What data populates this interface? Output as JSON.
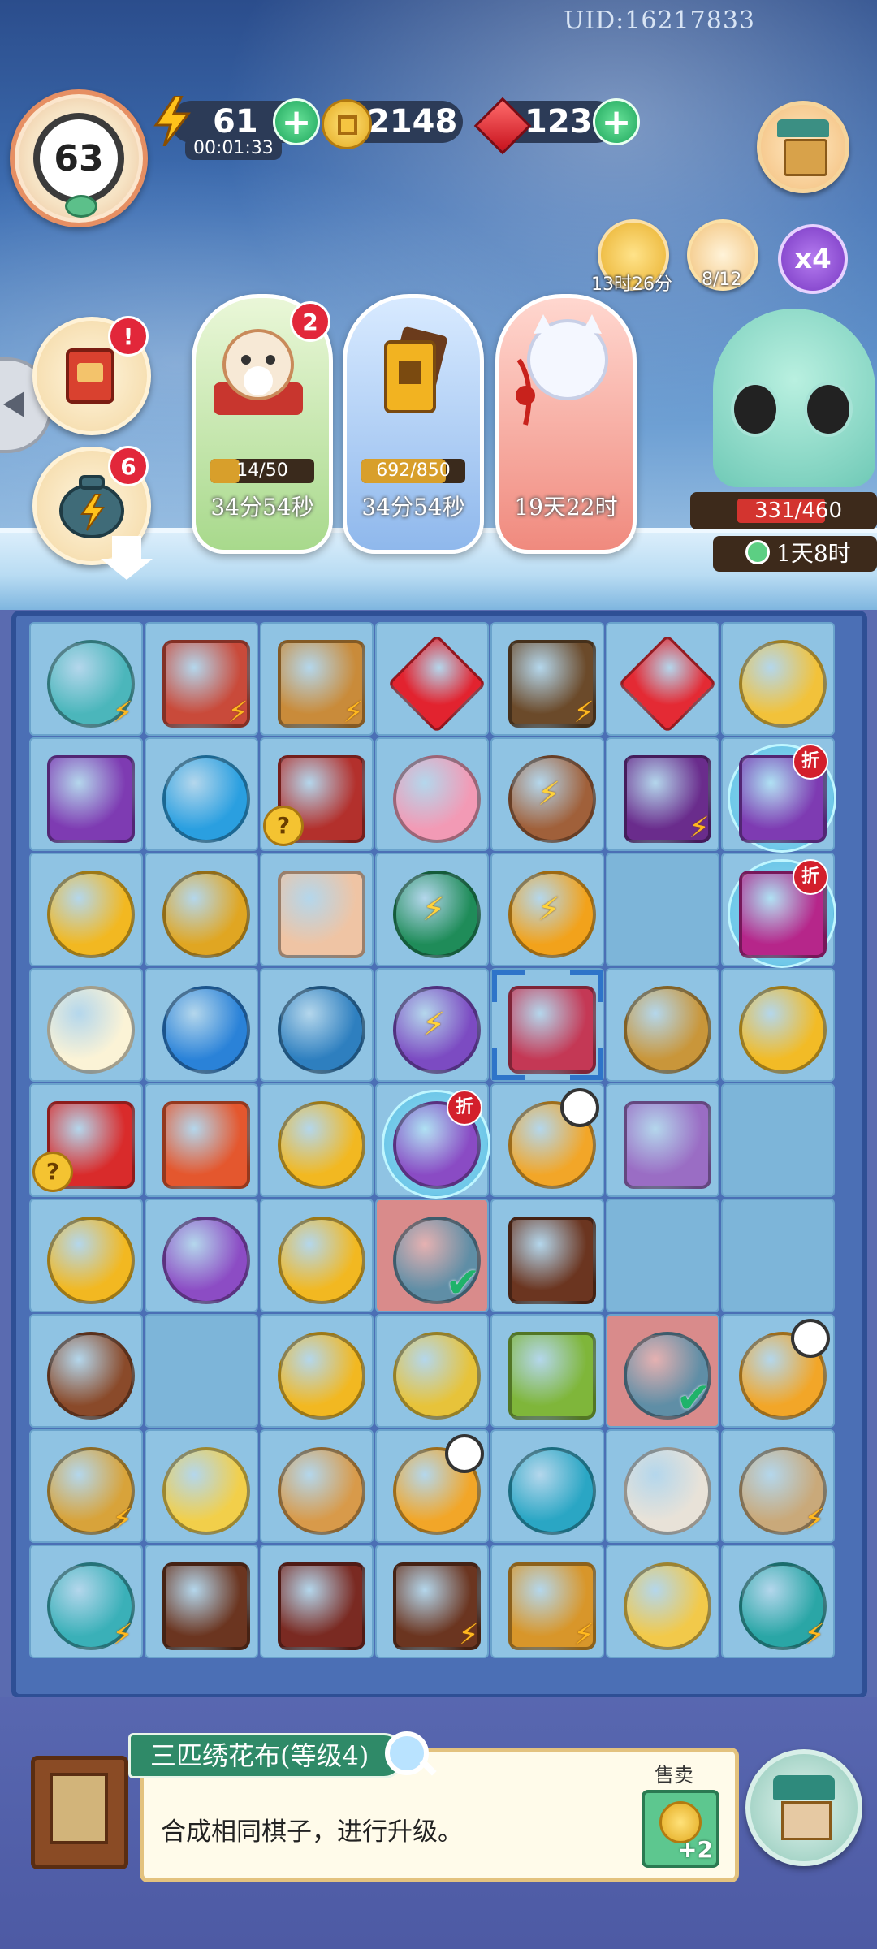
{
  "header": {
    "uid": "UID:16217833",
    "level": "63",
    "energy": {
      "value": "61",
      "timer": "00:01:33"
    },
    "coins": {
      "value": "2148"
    },
    "gems": {
      "value": "123"
    },
    "speed_multiplier": "x4",
    "timers": [
      {
        "icon": "wok-icon",
        "label": "13时26分"
      },
      {
        "icon": "cat-face-icon",
        "label": "8/12"
      }
    ]
  },
  "left_buttons": [
    {
      "icon": "book-icon",
      "badge": "!"
    },
    {
      "icon": "teapot-icon",
      "badge": "6"
    }
  ],
  "event_cards": [
    {
      "name": "cat-pillow-event",
      "badge": "2",
      "progress_text": "14/50",
      "progress": 0.28,
      "time": "34分54秒"
    },
    {
      "name": "ticket-event",
      "progress_text": "692/850",
      "progress": 0.81,
      "time": "34分54秒"
    },
    {
      "name": "lantern-event",
      "time": "19天22时"
    }
  ],
  "cat_panel": {
    "progress_text": "331/460",
    "progress": 0.72,
    "time": "1天8时"
  },
  "board": {
    "rows": [
      [
        {
          "icon": "teapot-icon",
          "color": "#4bb6bb",
          "shape": "round",
          "bolt": true
        },
        {
          "icon": "watermelon-crate-icon",
          "color": "#c94a3a",
          "shape": "square",
          "bolt": true
        },
        {
          "icon": "scroll-basket-icon",
          "color": "#c98b3a",
          "shape": "square",
          "bolt": true
        },
        {
          "icon": "ruby-cluster-icon",
          "color": "#e2232f",
          "shape": "diamond"
        },
        {
          "icon": "treasure-chest-icon",
          "color": "#6b4a2a",
          "shape": "square",
          "bolt": true
        },
        {
          "icon": "ruby-icon",
          "color": "#e42a34",
          "shape": "diamond"
        },
        {
          "icon": "jade-bracelet-icon",
          "color": "#f2c23a",
          "shape": "round"
        }
      ],
      [
        {
          "icon": "embroidered-pouch-icon",
          "color": "#7e3bb2",
          "shape": "square"
        },
        {
          "icon": "earrings-icon",
          "color": "#2a9fe0",
          "shape": "round"
        },
        {
          "icon": "mystery-box-icon",
          "color": "#b3302c",
          "shape": "square",
          "question": true
        },
        {
          "icon": "plum-blossom-icon",
          "color": "#f29ab5",
          "shape": "round"
        },
        {
          "icon": "gourd-bolt-icon",
          "color": "#a0603a",
          "shape": "round",
          "center_bolt": true
        },
        {
          "icon": "fabric-box-icon",
          "color": "#6a2c8c",
          "shape": "square",
          "bolt": true
        },
        {
          "icon": "embroidered-pouch-icon",
          "color": "#7e3bb2",
          "shape": "square",
          "sale": "折",
          "bubble": true
        }
      ],
      [
        {
          "icon": "coin-stack-icon",
          "color": "#f2b821",
          "shape": "round"
        },
        {
          "icon": "gold-bracelet-icon",
          "color": "#e0a622",
          "shape": "round"
        },
        {
          "icon": "scroll-roll-icon",
          "color": "#efc4a4",
          "shape": "square"
        },
        {
          "icon": "green-gourd-icon",
          "color": "#1f8c59",
          "shape": "round",
          "center_bolt": true
        },
        {
          "icon": "golden-gourd-icon",
          "color": "#f2a21b",
          "shape": "round",
          "center_bolt": true
        },
        {
          "empty": true
        },
        {
          "icon": "lucky-bag-icon",
          "color": "#b6268a",
          "shape": "square",
          "sale": "折",
          "bubble": true
        }
      ],
      [
        {
          "icon": "fried-egg-icon",
          "color": "#fbf3d6",
          "shape": "round"
        },
        {
          "icon": "blue-hairpin-icon",
          "color": "#2a82d8",
          "shape": "round"
        },
        {
          "icon": "tea-bowl-icon",
          "color": "#2e7fbf",
          "shape": "round"
        },
        {
          "icon": "purple-gourd-icon",
          "color": "#7c4bc2",
          "shape": "round",
          "center_bolt": true
        },
        {
          "icon": "fabric-bolts-icon",
          "color": "#c43855",
          "shape": "square",
          "selected": true
        },
        {
          "icon": "brush-set-icon",
          "color": "#c9963a",
          "shape": "round"
        },
        {
          "icon": "gold-hairpin-icon",
          "color": "#f2bb26",
          "shape": "round"
        }
      ],
      [
        {
          "icon": "gift-box-icon",
          "color": "#d92b2b",
          "shape": "square",
          "question": true
        },
        {
          "icon": "fruit-platter-icon",
          "color": "#e4572e",
          "shape": "square"
        },
        {
          "icon": "coin-icon",
          "color": "#f2b821",
          "shape": "round"
        },
        {
          "icon": "lucky-bag-icon",
          "color": "#8a4bc4",
          "shape": "round",
          "sale": "折",
          "bubble": true
        },
        {
          "icon": "hen-nest-icon",
          "color": "#f2a628",
          "shape": "round",
          "clock": true
        },
        {
          "icon": "fabric-roll-icon",
          "color": "#9a6dc4",
          "shape": "square"
        },
        {
          "empty": true
        }
      ],
      [
        {
          "icon": "coin-icon",
          "color": "#f2b821",
          "shape": "round"
        },
        {
          "icon": "purple-mirror-icon",
          "color": "#8c4cc4",
          "shape": "round"
        },
        {
          "icon": "coin-icon",
          "color": "#f2b821",
          "shape": "round"
        },
        {
          "icon": "jade-pendant-icon",
          "color": "#5f8ea6",
          "shape": "round",
          "red": true,
          "check": true
        },
        {
          "icon": "wooden-chest-icon",
          "color": "#6b3520",
          "shape": "square"
        },
        {
          "empty": true
        },
        {
          "empty": true
        }
      ],
      [
        {
          "icon": "empty-nest-icon",
          "color": "#8a4a2a",
          "shape": "round"
        },
        {
          "empty": true
        },
        {
          "icon": "coin-pile-icon",
          "color": "#f2b821",
          "shape": "round"
        },
        {
          "icon": "rice-bowl-icon",
          "color": "#e7c33a",
          "shape": "round"
        },
        {
          "icon": "bamboo-icon",
          "color": "#7fb63a",
          "shape": "square"
        },
        {
          "icon": "jade-pendant-icon",
          "color": "#5f8ea6",
          "shape": "round",
          "red": true,
          "check": true
        },
        {
          "icon": "hen-nest-icon",
          "color": "#f2a628",
          "shape": "round",
          "clock": true
        }
      ],
      [
        {
          "icon": "rice-jar-icon",
          "color": "#d8a33a",
          "shape": "round",
          "bolt": true
        },
        {
          "icon": "chick-nest-icon",
          "color": "#f2cf4a",
          "shape": "round"
        },
        {
          "icon": "egg-nest-icon",
          "color": "#d89a4a",
          "shape": "round"
        },
        {
          "icon": "hen-nest-icon",
          "color": "#f2a628",
          "shape": "round",
          "clock": true
        },
        {
          "icon": "jade-jar-icon",
          "color": "#2aa6c4",
          "shape": "round"
        },
        {
          "icon": "silk-cocoon-icon",
          "color": "#e8e2d8",
          "shape": "round"
        },
        {
          "icon": "spinning-wheel-icon",
          "color": "#c9a97a",
          "shape": "round",
          "bolt": true
        }
      ],
      [
        {
          "icon": "teapot-icon",
          "color": "#3ab0b8",
          "shape": "round",
          "bolt": true
        },
        {
          "icon": "wooden-box-icon",
          "color": "#6b3520",
          "shape": "square"
        },
        {
          "icon": "red-box-icon",
          "color": "#7a2a22",
          "shape": "square"
        },
        {
          "icon": "treasure-chest-icon",
          "color": "#6b3520",
          "shape": "square",
          "bolt": true
        },
        {
          "icon": "scroll-basket-icon",
          "color": "#d8962a",
          "shape": "square",
          "bolt": true
        },
        {
          "icon": "chicks-nest-icon",
          "color": "#f2c94a",
          "shape": "round"
        },
        {
          "icon": "teapot-set-icon",
          "color": "#2aa6a6",
          "shape": "round",
          "bolt": true
        }
      ]
    ]
  },
  "info_panel": {
    "title": "三匹绣花布(等级4)",
    "description": "合成相同棋子，进行升级。",
    "sell_label": "售卖",
    "sell_value": "+2"
  }
}
